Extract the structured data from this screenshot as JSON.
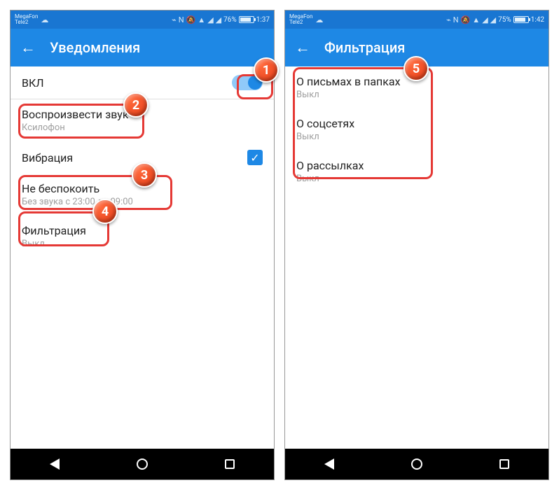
{
  "left": {
    "status": {
      "carrier1": "MegaFon",
      "carrier2": "Tele2",
      "battery": "76%",
      "time": "1:37"
    },
    "appbar_title": "Уведомления",
    "rows": {
      "enable": {
        "title": "ВКЛ"
      },
      "sound": {
        "title": "Воспроизвести звук",
        "sub": "Ксилофон"
      },
      "vibration": {
        "title": "Вибрация"
      },
      "dnd": {
        "title": "Не беспокоить",
        "sub": "Без звука с 23:00 до 09:00"
      },
      "filter": {
        "title": "Фильтрация",
        "sub": "Выкл"
      }
    }
  },
  "right": {
    "status": {
      "carrier1": "MegaFon",
      "carrier2": "Tele2",
      "battery": "75%",
      "time": "1:42"
    },
    "appbar_title": "Фильтрация",
    "rows": {
      "folders": {
        "title": "О письмах в папках",
        "sub": "Выкл"
      },
      "social": {
        "title": "О соцсетях",
        "sub": "Выкл"
      },
      "newsletters": {
        "title": "О рассылках",
        "sub": "Выкл"
      }
    }
  },
  "markers": {
    "m1": "1",
    "m2": "2",
    "m3": "3",
    "m4": "4",
    "m5": "5"
  }
}
